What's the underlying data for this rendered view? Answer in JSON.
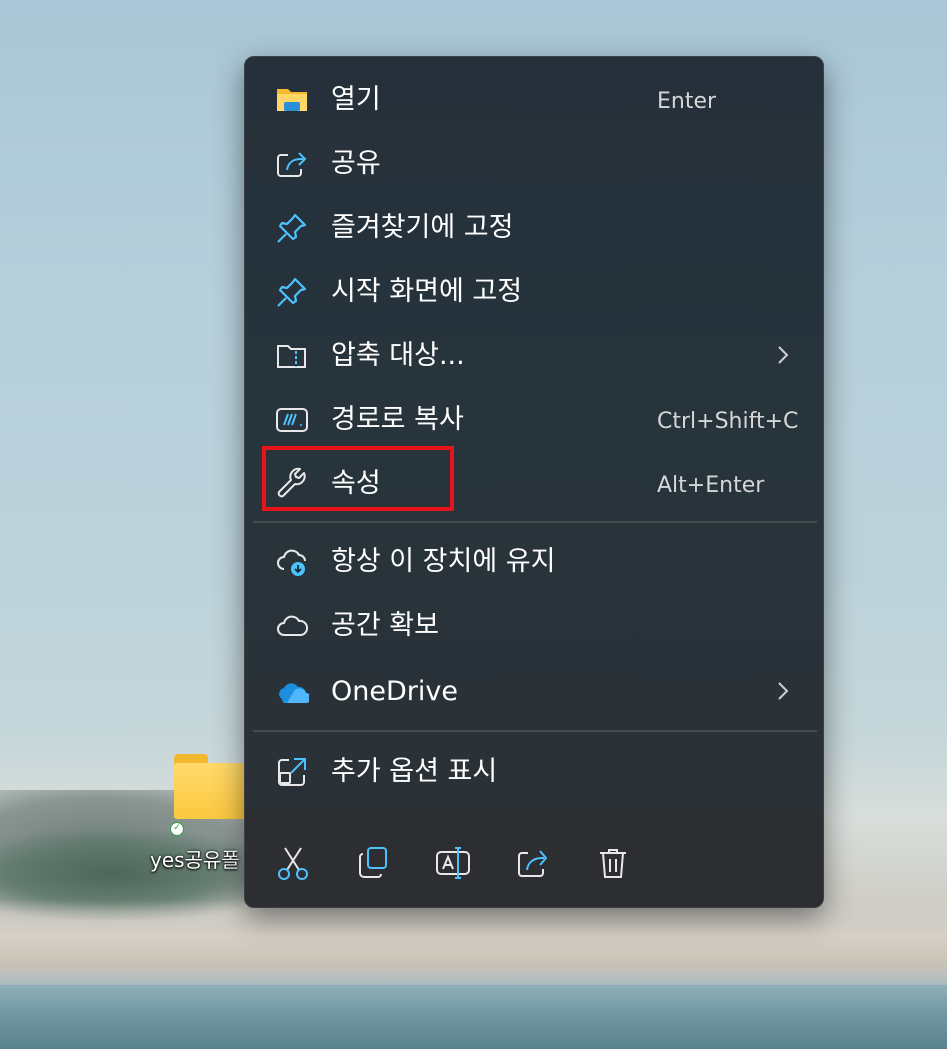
{
  "desktop": {
    "folder_label": "yes공유폴",
    "sync_status_icon": "green-check-icon"
  },
  "context_menu": {
    "items": [
      {
        "label": "열기",
        "shortcut": "Enter",
        "icon": "folder-open-icon"
      },
      {
        "label": "공유",
        "shortcut": "",
        "icon": "share-icon"
      },
      {
        "label": "즐겨찾기에 고정",
        "shortcut": "",
        "icon": "pin-icon"
      },
      {
        "label": "시작 화면에 고정",
        "shortcut": "",
        "icon": "pin-icon"
      },
      {
        "label": "압축 대상...",
        "shortcut": "",
        "icon": "zip-folder-icon",
        "submenu": true
      },
      {
        "label": "경로로 복사",
        "shortcut": "Ctrl+Shift+C",
        "icon": "copy-path-icon"
      },
      {
        "label": "속성",
        "shortcut": "Alt+Enter",
        "icon": "wrench-icon",
        "highlighted": true
      },
      {
        "label": "항상 이 장치에 유지",
        "shortcut": "",
        "icon": "cloud-download-icon"
      },
      {
        "label": "공간 확보",
        "shortcut": "",
        "icon": "cloud-icon"
      },
      {
        "label": "OneDrive",
        "shortcut": "",
        "icon": "onedrive-icon",
        "submenu": true
      },
      {
        "label": "추가 옵션 표시",
        "shortcut": "",
        "icon": "open-external-icon"
      }
    ],
    "toolbar": [
      "cut-icon",
      "copy-icon",
      "rename-icon",
      "share-icon",
      "delete-icon"
    ]
  },
  "colors": {
    "menu_background": "#2b2d31",
    "icon_accent": "#4cc2ff",
    "highlight_box": "#e8141b"
  }
}
